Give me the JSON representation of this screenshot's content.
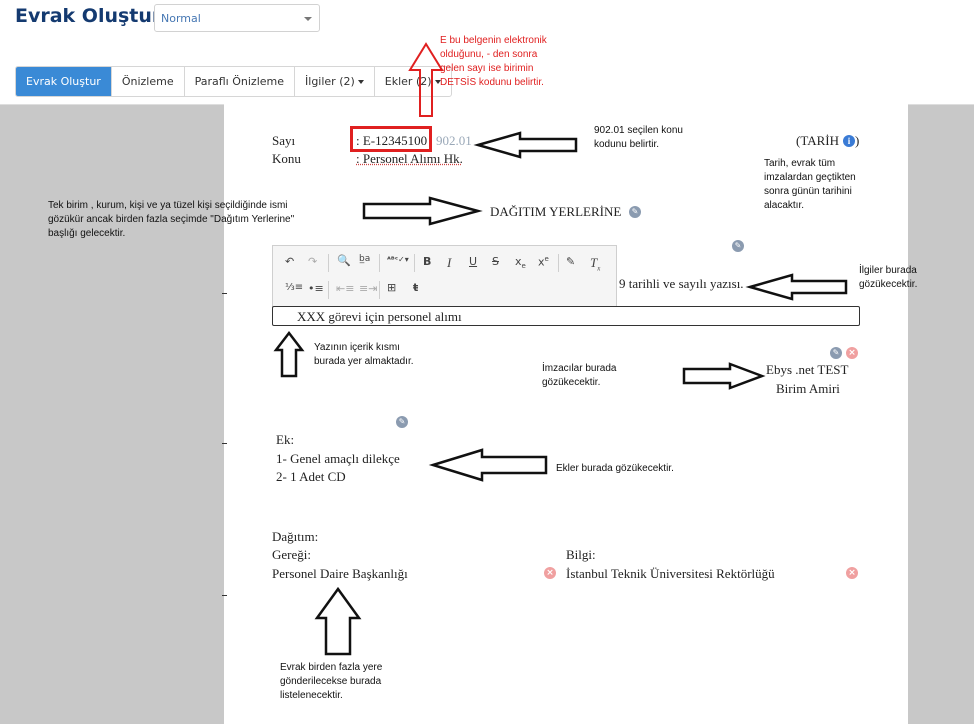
{
  "header": {
    "title": "Evrak Oluştur",
    "style_select": "Normal"
  },
  "tabs": [
    {
      "label": "Evrak Oluştur"
    },
    {
      "label": "Önizleme"
    },
    {
      "label": "Paraflı Önizleme"
    },
    {
      "label": "İlgiler (2)"
    },
    {
      "label": "Ekler (2)"
    }
  ],
  "document": {
    "sayi_label": "Sayı",
    "sayi_value": ": E-12345100",
    "sayi_suffix": "902.01",
    "konu_label": "Konu",
    "konu_value": ": Personel Alımı Hk.",
    "tarih": "(TARİH",
    "tarih_close": ")",
    "dagitim_header": "DAĞITIM YERLERİNE",
    "ilgi_text": "9 tarihli ve sayılı yazısı.",
    "content": "XXX görevi için personel alımı",
    "signer_name": "Ebys .net TEST",
    "signer_title": "Birim Amiri",
    "ek_label": "Ek:",
    "ek_items": [
      "1- Genel amaçlı dilekçe",
      "2- 1 Adet CD"
    ],
    "dagitim_label": "Dağıtım:",
    "geregi_label": "Gereği:",
    "bilgi_label": "Bilgi:",
    "geregi_item": "Personel Daire Başkanlığı",
    "bilgi_item": "İstanbul Teknik Üniversitesi Rektörlüğü"
  },
  "annotations": {
    "e_note": [
      "E bu belgenin elektronik",
      "olduğunu, - den sonra",
      "gelen sayı ise birimin",
      "DETSİS kodunu belirtir."
    ],
    "konu_note": [
      "902.01 seçilen konu",
      "kodunu belirtir."
    ],
    "tarih_note": [
      "Tarih, evrak tüm",
      "imzalardan geçtikten",
      "sonra günün tarihini",
      "alacaktır."
    ],
    "dagitim_note": [
      "Tek birim , kurum, kişi ve ya tüzel kişi seçildiğinde ismi",
      "gözükür ancak birden fazla seçimde \"Dağıtım Yerlerine\"",
      "başlığı gelecektir."
    ],
    "ilgi_note": [
      "İlgiler burada",
      "gözükecektir."
    ],
    "content_note": [
      "Yazının içerik kısmı",
      "burada yer almaktadır."
    ],
    "imza_note": [
      "İmzacılar burada",
      "gözükecektir."
    ],
    "ek_note": [
      "Ekler burada gözükecektir."
    ],
    "liste_note": [
      "Evrak birden fazla yere",
      "gönderilecekse burada",
      "listelenecektir."
    ]
  },
  "colors": {
    "accent": "#3a8ad6",
    "title": "#143a70",
    "annotation_red": "#e02020",
    "page_bg": "#c8c8c8"
  },
  "icons": [
    "undo-icon",
    "redo-icon",
    "find-icon",
    "replace-icon",
    "spellcheck-icon",
    "bold-icon",
    "italic-icon",
    "underline-icon",
    "strike-icon",
    "subscript-icon",
    "superscript-icon",
    "format-paint-icon",
    "clear-format-icon",
    "ordered-list-icon",
    "bullet-list-icon",
    "outdent-icon",
    "indent-icon",
    "table-icon",
    "special-icon",
    "pencil-icon",
    "remove-icon",
    "info-icon"
  ]
}
